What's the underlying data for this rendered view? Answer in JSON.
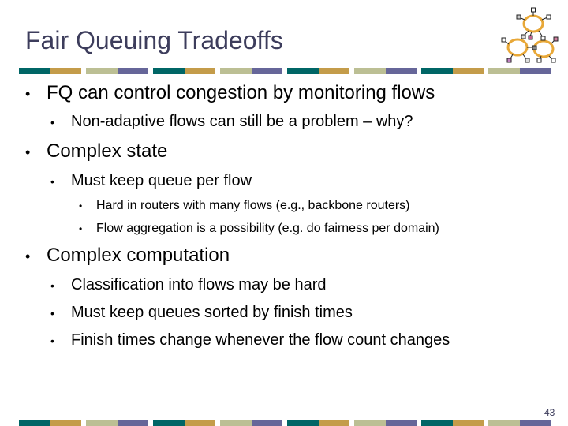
{
  "slide": {
    "title": "Fair Queuing Tradeoffs",
    "page_number": "43",
    "logo_icon": "network-rings-logo",
    "bullet_glyph": "•",
    "colors": {
      "title": "#3d3d5c",
      "bar_teal": "#006666",
      "bar_gold": "#c49c4a",
      "bar_sage": "#bcbf94",
      "bar_purple": "#666699",
      "logo_ring": "#e8a838"
    },
    "bullets": [
      {
        "level": 1,
        "text": "FQ can control congestion by monitoring flows",
        "children": [
          {
            "level": 2,
            "text": "Non-adaptive flows can still be a problem – why?"
          }
        ]
      },
      {
        "level": 1,
        "text": "Complex state",
        "children": [
          {
            "level": 2,
            "text": "Must keep queue per flow",
            "children": [
              {
                "level": 3,
                "text": "Hard in routers with many flows (e.g., backbone routers)"
              },
              {
                "level": 3,
                "text": "Flow aggregation is a possibility (e.g. do fairness per domain)"
              }
            ]
          }
        ]
      },
      {
        "level": 1,
        "text": "Complex computation",
        "children": [
          {
            "level": 2,
            "text": "Classification into flows may be hard"
          },
          {
            "level": 2,
            "text": "Must keep queues sorted by finish times"
          },
          {
            "level": 2,
            "text": "Finish times change whenever the flow count changes"
          }
        ]
      }
    ]
  }
}
